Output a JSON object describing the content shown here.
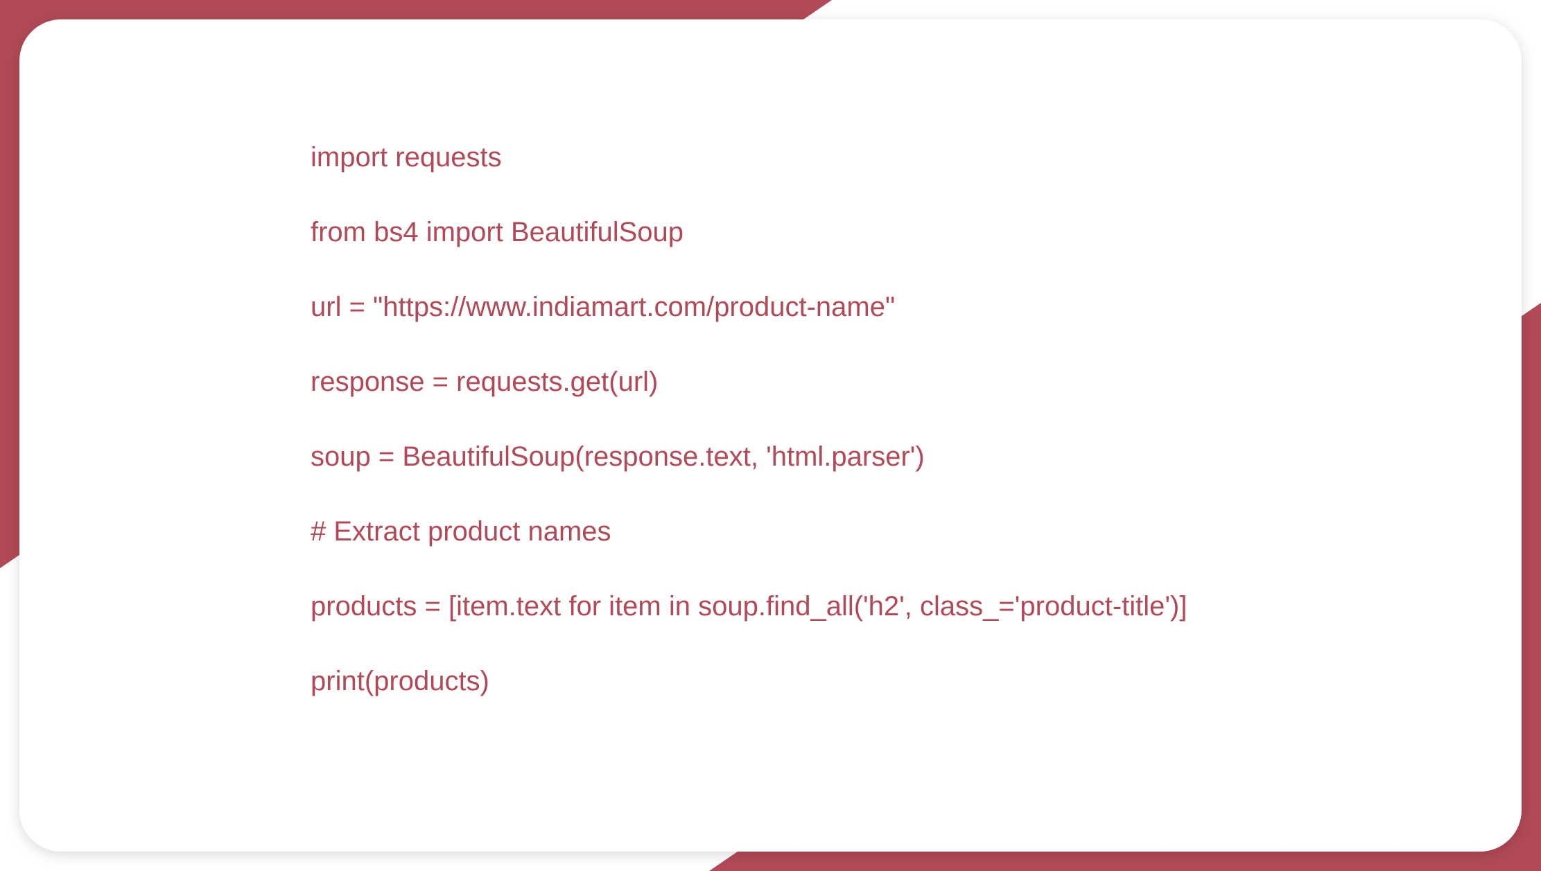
{
  "code": {
    "lines": [
      "import requests",
      "from bs4 import BeautifulSoup",
      "url = \"https://www.indiamart.com/product-name\"",
      "response = requests.get(url)",
      "soup = BeautifulSoup(response.text, 'html.parser')",
      "# Extract product names",
      "products = [item.text for item in soup.find_all('h2', class_='product-title')]",
      "print(products)"
    ]
  }
}
